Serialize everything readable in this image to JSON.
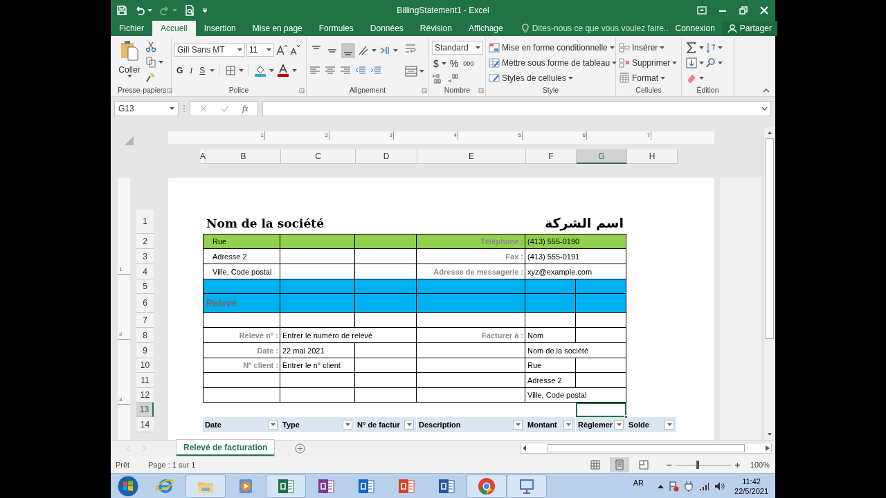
{
  "window": {
    "title": "BillingStatement1 - Excel"
  },
  "menu_tabs": [
    {
      "label": "Fichier",
      "selected": false
    },
    {
      "label": "Accueil",
      "selected": true
    },
    {
      "label": "Insertion",
      "selected": false
    },
    {
      "label": "Mise en page",
      "selected": false
    },
    {
      "label": "Formules",
      "selected": false
    },
    {
      "label": "Données",
      "selected": false
    },
    {
      "label": "Révision",
      "selected": false
    },
    {
      "label": "Affichage",
      "selected": false
    }
  ],
  "tell_me": {
    "placeholder": "Dites-nous ce que vous voulez faire.."
  },
  "account": {
    "sign_in": "Connexion",
    "share": "Partager"
  },
  "ribbon": {
    "clipboard": {
      "paste": "Coller",
      "label": "Presse-papiers"
    },
    "font": {
      "name": "Gill Sans MT",
      "size": "11",
      "bold": "G",
      "italic": "I",
      "underline": "S",
      "label": "Police"
    },
    "alignment": {
      "label": "Alignement",
      "vertical_buttons": [
        {
          "selected": false
        },
        {
          "selected": false
        },
        {
          "selected": true
        }
      ]
    },
    "number": {
      "format": "Standard",
      "currency": "$",
      "percent": "%",
      "thousands": "000",
      "label": "Nombre"
    },
    "styles": {
      "items": [
        "Mise en forme conditionnelle",
        "Mettre sous forme de tableau",
        "Styles de cellules"
      ],
      "label": "Style"
    },
    "cells": {
      "items": [
        "Insérer",
        "Supprimer",
        "Format"
      ],
      "label": "Cellules"
    },
    "editing": {
      "label": "Édition"
    }
  },
  "formula_bar": {
    "name_box": "G13",
    "function_label": "fx"
  },
  "ruler": {
    "marks": [
      "1",
      "2",
      "3",
      "4",
      "5",
      "6",
      "7"
    ]
  },
  "vertical_ruler": {
    "marks": [
      "1",
      "2",
      "3"
    ]
  },
  "columns": [
    {
      "label": "A",
      "selected": false
    },
    {
      "label": "B",
      "selected": false
    },
    {
      "label": "C",
      "selected": false
    },
    {
      "label": "D",
      "selected": false
    },
    {
      "label": "E",
      "selected": false
    },
    {
      "label": "F",
      "selected": false
    },
    {
      "label": "G",
      "selected": true
    },
    {
      "label": "H",
      "selected": false
    }
  ],
  "rows": [
    {
      "number": "1",
      "selected": false,
      "cells": [
        {
          "kind": "title",
          "text": "Nom de la société"
        },
        {
          "kind": "arabic",
          "text": "اسم الشركة"
        }
      ]
    },
    {
      "number": "2",
      "selected": false,
      "color": "#92d050",
      "cells": [
        {
          "kind": "indent_cell",
          "text": "Rue"
        },
        {
          "kind": "cell"
        },
        {
          "kind": "cell"
        },
        {
          "kind": "label",
          "text": "Téléphone :"
        },
        {
          "kind": "cell",
          "text": "(413) 555-0190"
        }
      ]
    },
    {
      "number": "3",
      "selected": false,
      "cells": [
        {
          "kind": "indent_cell",
          "text": "Adresse 2"
        },
        {
          "kind": "cell"
        },
        {
          "kind": "cell"
        },
        {
          "kind": "label",
          "text": "Fax :"
        },
        {
          "kind": "cell",
          "text": "(413) 555-0191"
        }
      ]
    },
    {
      "number": "4",
      "selected": false,
      "cells": [
        {
          "kind": "indent_cell",
          "text": "Ville, Code postal"
        },
        {
          "kind": "cell"
        },
        {
          "kind": "cell"
        },
        {
          "kind": "label",
          "text": "Adresse de messagerie :"
        },
        {
          "kind": "cell",
          "text": "xyz@example.com"
        }
      ]
    },
    {
      "number": "5",
      "selected": false,
      "color": "#00b0f0",
      "cells": [
        {
          "kind": "cell"
        },
        {
          "kind": "cell"
        },
        {
          "kind": "cell"
        },
        {
          "kind": "cell"
        },
        {
          "kind": "cell"
        },
        {
          "kind": "cell"
        }
      ]
    },
    {
      "number": "6",
      "selected": false,
      "color": "#00b0f0",
      "cells": [
        {
          "kind": "banner",
          "text": "Relevé"
        },
        {
          "kind": "cell"
        },
        {
          "kind": "cell"
        },
        {
          "kind": "cell"
        },
        {
          "kind": "cell"
        },
        {
          "kind": "cell"
        }
      ]
    },
    {
      "number": "7",
      "selected": false,
      "cells": [
        {
          "kind": "cell"
        },
        {
          "kind": "cell"
        },
        {
          "kind": "cell"
        },
        {
          "kind": "cell"
        },
        {
          "kind": "cell"
        },
        {
          "kind": "cell"
        }
      ]
    },
    {
      "number": "8",
      "selected": false,
      "cells": [
        {
          "kind": "label",
          "text": "Relevé n° :"
        },
        {
          "kind": "cell",
          "text": "Entrer le numéro de relevé"
        },
        {
          "kind": "label",
          "text": "Facturer à :"
        },
        {
          "kind": "cell",
          "text": "Nom"
        },
        {
          "kind": "cell"
        }
      ]
    },
    {
      "number": "9",
      "selected": false,
      "cells": [
        {
          "kind": "label",
          "text": "Date :"
        },
        {
          "kind": "cell",
          "text": "22 mai 2021"
        },
        {
          "kind": "cell"
        },
        {
          "kind": "cell"
        },
        {
          "kind": "cell",
          "text": "Nom de la société"
        }
      ]
    },
    {
      "number": "10",
      "selected": false,
      "cells": [
        {
          "kind": "label",
          "text": "N° client :"
        },
        {
          "kind": "cell",
          "text": "Entrer le n° client"
        },
        {
          "kind": "cell"
        },
        {
          "kind": "cell"
        },
        {
          "kind": "cell",
          "text": "Rue"
        },
        {
          "kind": "cell"
        }
      ]
    },
    {
      "number": "11",
      "selected": false,
      "cells": [
        {
          "kind": "cell"
        },
        {
          "kind": "cell"
        },
        {
          "kind": "cell"
        },
        {
          "kind": "cell"
        },
        {
          "kind": "cell",
          "text": "Adresse 2"
        },
        {
          "kind": "cell"
        }
      ]
    },
    {
      "number": "12",
      "selected": false,
      "cells": [
        {
          "kind": "cell"
        },
        {
          "kind": "cell"
        },
        {
          "kind": "cell"
        },
        {
          "kind": "cell"
        },
        {
          "kind": "cell",
          "text": "Ville, Code postal"
        }
      ]
    },
    {
      "number": "13",
      "selected": true,
      "cells": [
        {
          "kind": "blank"
        },
        {
          "kind": "active"
        }
      ]
    },
    {
      "number": "14",
      "selected": false,
      "color": "#dce6f1",
      "cells": [
        {
          "kind": "header",
          "text": "Date"
        },
        {
          "kind": "header",
          "text": "Type"
        },
        {
          "kind": "header",
          "text": "N° de factur"
        },
        {
          "kind": "header",
          "text": "Description"
        },
        {
          "kind": "header",
          "text": "Montant"
        },
        {
          "kind": "header",
          "text": "Règlemer"
        },
        {
          "kind": "header",
          "text": "Solde"
        }
      ]
    }
  ],
  "sheet_tabs": [
    {
      "label": "Relevé de facturation",
      "selected": true
    }
  ],
  "status_bar": {
    "status": "Prêt",
    "page": "Page : 1 sur 1",
    "views": [
      {
        "selected": false
      },
      {
        "selected": true
      },
      {
        "selected": false
      }
    ],
    "zoom": {
      "level": 0.4,
      "reading": "100%"
    }
  },
  "taskbar": {
    "apps": [
      {
        "kind": "ie",
        "running": false
      },
      {
        "kind": "explorer",
        "running": true
      },
      {
        "kind": "media",
        "running": false
      },
      {
        "kind": "excel",
        "running": true
      },
      {
        "kind": "onenote",
        "running": false
      },
      {
        "kind": "outlook",
        "running": false
      },
      {
        "kind": "powerpoint",
        "running": false
      },
      {
        "kind": "word",
        "running": false
      },
      {
        "kind": "chrome",
        "running": true
      },
      {
        "kind": "remote",
        "running": true
      }
    ],
    "language": "AR",
    "time": "11:42",
    "date": "22/5/2021"
  }
}
